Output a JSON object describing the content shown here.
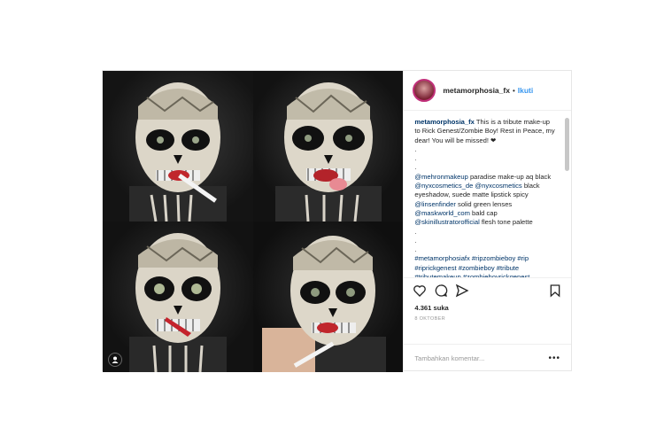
{
  "post": {
    "username": "metamorphosia_fx",
    "separator": "•",
    "follow_label": "Ikuti",
    "caption": {
      "username": "metamorphosia_fx",
      "text": "This is a tribute make-up to Rick Genest/Zombie Boy! Rest in Peace, my dear! You will be missed! ❤",
      "dots": [
        ".",
        ".",
        "."
      ],
      "credits": [
        {
          "handle": "@mehronmakeup",
          "text": " paradise make-up aq black"
        },
        {
          "handle": "@nyxcosmetics_de @nyxcosmetics",
          "text": " black eyeshadow, suede matte lipstick spicy"
        },
        {
          "handle": "@linsenfinder",
          "text": " solid green lenses"
        },
        {
          "handle": "@maskworld_com",
          "text": " bald cap"
        },
        {
          "handle": "@skinillustratorofficial",
          "text": " flesh tone palette"
        }
      ],
      "dots2": [
        ".",
        ".",
        "."
      ],
      "hashtags": "#metamorphosiafx #ripzombieboy #rip #riprickgenest #zombieboy #tribute #tributemakeup #zombieboyrickgenest #zombieboymakeup #skinillustrator #zombietattoo #zombie #makeupartist"
    },
    "likes": "4.361 suka",
    "date": "8 OKTOBER",
    "comment_placeholder": "Tambahkan komentar...",
    "more_label": "•••",
    "icons": [
      "heart-icon",
      "comment-icon",
      "share-icon",
      "bookmark-icon",
      "user-tag-icon",
      "more-options-icon"
    ]
  }
}
